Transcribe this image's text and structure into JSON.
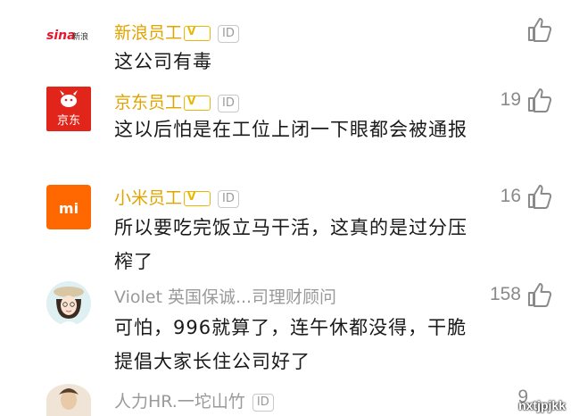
{
  "comments": [
    {
      "username": "新浪员工",
      "id_badge": "ID",
      "avatar_brand": "sina",
      "avatar_text": "新浪",
      "text": "这公司有毒",
      "likes": ""
    },
    {
      "username": "京东员工",
      "id_badge": "ID",
      "avatar_brand": "jd",
      "avatar_text": "京东",
      "text": "这以后怕是在工位上闭一下眼都会被通报",
      "likes": "19"
    },
    {
      "username": "小米员工",
      "id_badge": "ID",
      "avatar_brand": "xiaomi",
      "avatar_text": "mi",
      "text": "所以要吃完饭立马干活，这真的是过分压榨了",
      "likes": "16"
    },
    {
      "username": "Violet 英国保诚...司理财顾问",
      "avatar_brand": "violet",
      "text": "可怕，996就算了，连午休都没得，干脆提倡大家长住公司好了",
      "likes": "158"
    },
    {
      "username": "人力HR.一坨山竹",
      "id_badge": "ID",
      "avatar_brand": "hr",
      "text": "",
      "likes": "9"
    }
  ],
  "watermark": "nxtjpjkk",
  "colors": {
    "username_gold": "#e0a400",
    "username_grey": "#9a9a9a",
    "sina_red": "#e6162d",
    "jd_red": "#e1251b",
    "xiaomi_orange": "#ff6700"
  },
  "icons": {
    "like": "thumbs-up-icon",
    "verified": "verified-v-badge-icon"
  }
}
